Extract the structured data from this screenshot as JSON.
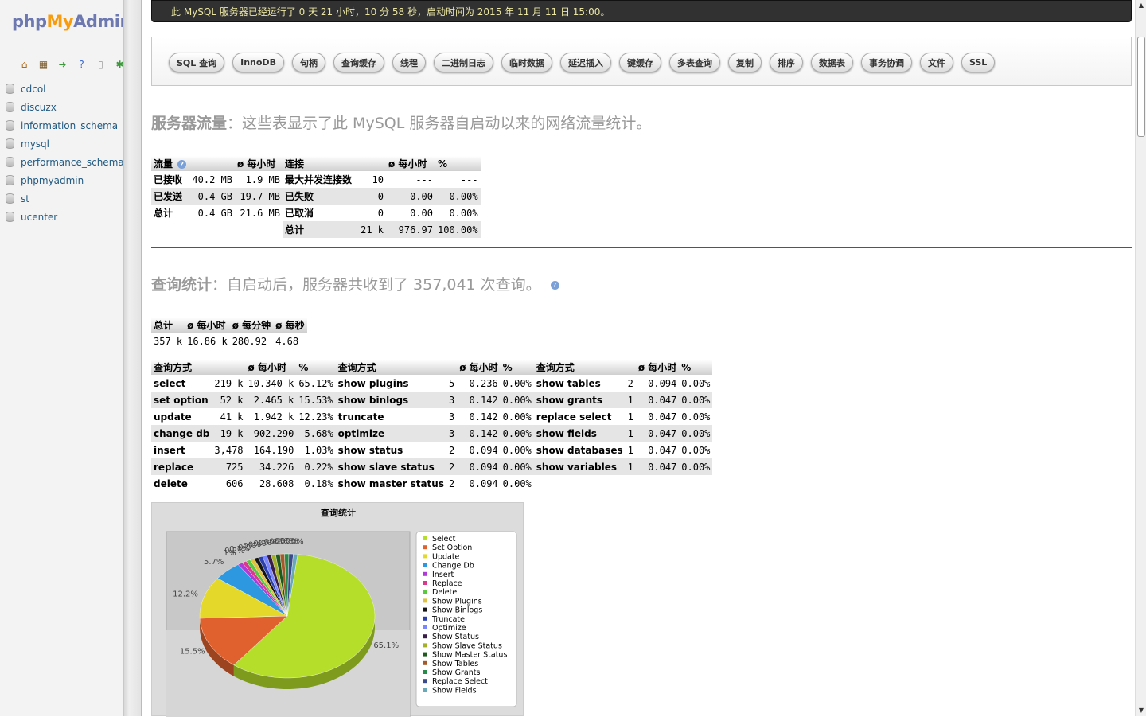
{
  "nav": {
    "logo_php": "php",
    "logo_my": "My",
    "logo_admin": "Admin",
    "icons": [
      "home-icon",
      "sql-window-icon",
      "logout-icon",
      "docs-icon",
      "settings-icon",
      "reload-icon"
    ],
    "databases": [
      "cdcol",
      "discuzx",
      "information_schema",
      "mysql",
      "performance_schema",
      "phpmyadmin",
      "st",
      "ucenter"
    ]
  },
  "uptime_text": "此 MySQL 服务器已经运行了 0 天 21 小时，10 分 58 秒，启动时间为 2015 年 11 月 11 日 15:00。",
  "tabs": [
    "SQL 查询",
    "InnoDB",
    "句柄",
    "查询缓存",
    "线程",
    "二进制日志",
    "临时数据",
    "延迟插入",
    "键缓存",
    "多表查询",
    "复制",
    "排序",
    "数据表",
    "事务协调",
    "文件",
    "SSL"
  ],
  "traffic_section": {
    "title_bold": "服务器流量",
    "title_rest": "：这些表显示了此 MySQL 服务器自启动以来的网络流量统计。",
    "headers": [
      "流量",
      "ø 每小时",
      "连接",
      "ø 每小时",
      "%"
    ],
    "rows": [
      {
        "label": "已接收",
        "value": "40.2 MB",
        "per_hour": "1.9 MB",
        "conn_label": "最大并发连接数",
        "conn_value": "10",
        "conn_per_hour": "---",
        "conn_pct": "---"
      },
      {
        "label": "已发送",
        "value": "0.4 GB",
        "per_hour": "19.7 MB",
        "conn_label": "已失败",
        "conn_value": "0",
        "conn_per_hour": "0.00",
        "conn_pct": "0.00%"
      },
      {
        "label": "总计",
        "value": "0.4 GB",
        "per_hour": "21.6 MB",
        "conn_label": "已取消",
        "conn_value": "0",
        "conn_per_hour": "0.00",
        "conn_pct": "0.00%"
      },
      {
        "label": "",
        "value": "",
        "per_hour": "",
        "conn_label": "总计",
        "conn_value": "21 k",
        "conn_per_hour": "976.97",
        "conn_pct": "100.00%"
      }
    ]
  },
  "query_section": {
    "title_bold": "查询统计",
    "title_rest": "：自启动后，服务器共收到了 357,041 次查询。",
    "summary_headers": [
      "总计",
      "ø 每小时",
      "ø 每分钟",
      "ø 每秒"
    ],
    "summary_values": [
      "357 k",
      "16.86 k",
      "280.92",
      "4.68"
    ],
    "detail_headers": [
      "查询方式",
      "ø 每小时",
      "%",
      "查询方式",
      "ø 每小时",
      "%",
      "查询方式",
      "ø 每小时",
      "%"
    ],
    "detail_rows": [
      [
        [
          "select",
          "219 k",
          "10.340 k",
          "65.12%"
        ],
        [
          "show plugins",
          "5",
          "0.236",
          "0.00%"
        ],
        [
          "show tables",
          "2",
          "0.094",
          "0.00%"
        ]
      ],
      [
        [
          "set option",
          "52 k",
          "2.465 k",
          "15.53%"
        ],
        [
          "show binlogs",
          "3",
          "0.142",
          "0.00%"
        ],
        [
          "show grants",
          "1",
          "0.047",
          "0.00%"
        ]
      ],
      [
        [
          "update",
          "41 k",
          "1.942 k",
          "12.23%"
        ],
        [
          "truncate",
          "3",
          "0.142",
          "0.00%"
        ],
        [
          "replace select",
          "1",
          "0.047",
          "0.00%"
        ]
      ],
      [
        [
          "change db",
          "19 k",
          "902.290",
          "5.68%"
        ],
        [
          "optimize",
          "3",
          "0.142",
          "0.00%"
        ],
        [
          "show fields",
          "1",
          "0.047",
          "0.00%"
        ]
      ],
      [
        [
          "insert",
          "3,478",
          "164.190",
          "1.03%"
        ],
        [
          "show status",
          "2",
          "0.094",
          "0.00%"
        ],
        [
          "show databases",
          "1",
          "0.047",
          "0.00%"
        ]
      ],
      [
        [
          "replace",
          "725",
          "34.226",
          "0.22%"
        ],
        [
          "show slave status",
          "2",
          "0.094",
          "0.00%"
        ],
        [
          "show variables",
          "1",
          "0.047",
          "0.00%"
        ]
      ],
      [
        [
          "delete",
          "606",
          "28.608",
          "0.18%"
        ],
        [
          "show master status",
          "2",
          "0.094",
          "0.00%"
        ],
        null
      ]
    ]
  },
  "chart_data": {
    "type": "pie",
    "title": "查询统计",
    "categories": [
      "Select",
      "Set Option",
      "Update",
      "Change Db",
      "Insert",
      "Replace",
      "Delete",
      "Show Plugins",
      "Show Binlogs",
      "Truncate",
      "Optimize",
      "Show Status",
      "Show Slave Status",
      "Show Master Status",
      "Show Tables",
      "Show Grants",
      "Replace Select",
      "Show Fields"
    ],
    "values": [
      65.1,
      15.5,
      12.2,
      5.7,
      1,
      0.2,
      0.2,
      0,
      0,
      0,
      0,
      0,
      0,
      0,
      0,
      0,
      0,
      0
    ],
    "slice_labels": [
      "65.1%",
      "15.5%",
      "12.2%",
      "5.7%",
      "1%",
      "0.2%",
      "0.2%",
      "0%",
      "0%",
      "0%",
      "0%",
      "0%",
      "0%",
      "0%",
      "0%",
      "0%",
      "0%",
      "0%"
    ],
    "colors": [
      "#b5de2a",
      "#e0612e",
      "#e4d82a",
      "#2d97e0",
      "#b03ad6",
      "#d93a8e",
      "#5ac840",
      "#e0c040",
      "#151515",
      "#2b3fb0",
      "#7a86ff",
      "#3a1e4a",
      "#a4b02a",
      "#1e5a1e",
      "#a45a2a",
      "#2a8a4a",
      "#3a4a8a",
      "#6aa8b8"
    ],
    "legend_position": "right"
  }
}
